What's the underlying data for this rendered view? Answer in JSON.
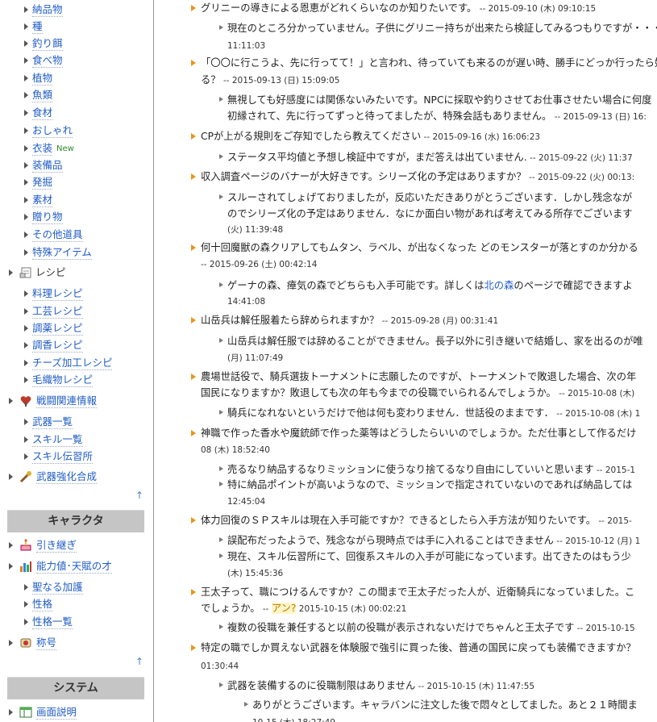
{
  "sidebar": {
    "items": [
      {
        "label": "納品物",
        "type": "link"
      },
      {
        "label": "種",
        "type": "link"
      },
      {
        "label": "釣り餌",
        "type": "link"
      },
      {
        "label": "食べ物",
        "type": "link"
      },
      {
        "label": "植物",
        "type": "link"
      },
      {
        "label": "魚類",
        "type": "link"
      },
      {
        "label": "食材",
        "type": "link"
      },
      {
        "label": "おしゃれ",
        "type": "link"
      },
      {
        "label": "衣装",
        "type": "link",
        "badge": "New"
      },
      {
        "label": "装備品",
        "type": "link"
      },
      {
        "label": "発掘",
        "type": "link"
      },
      {
        "label": "素材",
        "type": "link"
      },
      {
        "label": "贈り物",
        "type": "link"
      },
      {
        "label": "その他道具",
        "type": "link"
      },
      {
        "label": "特殊アイテム",
        "type": "link"
      },
      {
        "label": "レシピ",
        "type": "section",
        "icon": "recipe-icon"
      },
      {
        "label": "料理レシピ",
        "type": "link"
      },
      {
        "label": "工芸レシピ",
        "type": "link"
      },
      {
        "label": "調薬レシピ",
        "type": "link"
      },
      {
        "label": "調香レシピ",
        "type": "link"
      },
      {
        "label": "チーズ加工レシピ",
        "type": "link"
      },
      {
        "label": "毛織物レシピ",
        "type": "link"
      },
      {
        "label": "戦闘関連情報",
        "type": "section-link",
        "icon": "heart-shield-icon"
      },
      {
        "label": "武器一覧",
        "type": "link"
      },
      {
        "label": "スキル一覧",
        "type": "link"
      },
      {
        "label": "スキル伝習所",
        "type": "link"
      },
      {
        "label": "武器強化合成",
        "type": "section-link",
        "icon": "weapon-icon"
      }
    ],
    "chara_header": "キャラクタ",
    "chara_items": [
      {
        "label": "引き継ぎ",
        "type": "section-link",
        "icon": "cake-icon"
      },
      {
        "label": "能力値･天賦の才",
        "type": "section-link",
        "icon": "bar-chart-icon"
      },
      {
        "label": "聖なる加護",
        "type": "link"
      },
      {
        "label": "性格",
        "type": "link"
      },
      {
        "label": "性格一覧",
        "type": "link"
      },
      {
        "label": "称号",
        "type": "section-link",
        "icon": "trophy-icon"
      }
    ],
    "system_header": "システム",
    "system_items": [
      {
        "label": "画面説明",
        "type": "section-link",
        "icon": "screen-icon"
      }
    ],
    "up_arrow": "↑"
  },
  "main": {
    "lines": [
      {
        "kind": "q",
        "text": "グリニーの導きによる恩恵がどれくらいなのか知りたいです。",
        "ts": " -- 2015-09-10 (木) 09:10:15"
      },
      {
        "kind": "a",
        "text": "現在のところ分かっていません。子供にグリニー持ちが出来たら検証してみるつもりですが・・・"
      },
      {
        "kind": "c",
        "ts": "11:11:03"
      },
      {
        "kind": "q",
        "text": "「〇〇に行こうよ、先に行ってて！」と言われ、待っていても来るのが遅い時、勝手にどっか行ったら好感度は下が"
      },
      {
        "kind": "c",
        "text": "る？",
        "ts": " -- 2015-09-13 (日) 15:09:05"
      },
      {
        "kind": "a",
        "text": "無視しても好感度には関係ないみたいです。NPCに採取や釣りさせてお仕事させたい場合に何度"
      },
      {
        "kind": "c",
        "text": "初縁されて、先に行ってずっと待ってましたが、特殊会話もありません。",
        "ts": " -- 2015-09-13 (日) 16:"
      },
      {
        "kind": "q",
        "text": "CPが上がる規則をご存知でしたら教えてください",
        "ts": " -- 2015-09-16 (水) 16:06:23"
      },
      {
        "kind": "a",
        "text": "ステータス平均値と予想し検証中ですが，まだ答えは出ていません.",
        "ts": "  -- 2015-09-22 (火) 11:37"
      },
      {
        "kind": "q",
        "text": "収入調査ページのバナーが大好きです。シリーズ化の予定はありますか？",
        "ts": " -- 2015-09-22 (火) 00:13:"
      },
      {
        "kind": "a",
        "text": "スルーされてしょげておりましたが，反応いただきありがとうございます．しかし残念なが"
      },
      {
        "kind": "c",
        "text": "のでシリーズ化の予定はありません．なにか面白い物があれば考えてみる所存でございます"
      },
      {
        "kind": "c",
        "ts": "(火) 11:39:48"
      },
      {
        "kind": "q",
        "text": "何十回魔獣の森クリアしてもムタン、ラベル、が出なくなった どのモンスターが落とすのか分かる"
      },
      {
        "kind": "c",
        "ts": "-- 2015-09-26 (土) 00:42:14"
      },
      {
        "kind": "a",
        "text": "ゲーナの森、瘴気の森でどちらも入手可能です。詳しくは",
        "link": "北の森",
        "after": "のページで確認できますよ"
      },
      {
        "kind": "c",
        "ts": "14:41:08"
      },
      {
        "kind": "q",
        "text": "山岳兵は解任服着たら辞められますか？",
        "ts": " -- 2015-09-28 (月) 00:31:41"
      },
      {
        "kind": "a",
        "text": "山岳兵は解任服では辞めることができません。長子以外に引き継いで結婚し、家を出るのが唯"
      },
      {
        "kind": "c",
        "ts": "(月) 11:07:49"
      },
      {
        "kind": "q",
        "text": "農場世話役で、騎兵選抜トーナメントに志願したのですが、トーナメントで敗退した場合、次の年"
      },
      {
        "kind": "c",
        "text": "国民になりますか？敗退しても次の年も今までの役職でいられるんでしょうか。",
        "ts": " -- 2015-10-08 (木)"
      },
      {
        "kind": "a",
        "text": "騎兵になれないというだけで他は何も変わりません．世話役のままです．",
        "ts": "  -- 2015-10-08 (木) 1"
      },
      {
        "kind": "q",
        "text": "神職で作った香水や魔銃師で作った薬等はどうしたらいいのでしょうか。ただ仕事として作るだけ"
      },
      {
        "kind": "c",
        "ts": "08 (木) 18:52:40"
      },
      {
        "kind": "a",
        "text": "売るなり納品するなりミッションに使うなり捨てるなり自由にしていいと思います",
        "ts": " -- 2015-1"
      },
      {
        "kind": "a",
        "text": "特に納品ポイントが高いようなので、ミッションで指定されていないのであれば納品しては"
      },
      {
        "kind": "c",
        "ts": "12:45:04"
      },
      {
        "kind": "q",
        "text": "体力回復のＳＰスキルは現在入手可能ですか？できるとしたら入手方法が知りたいです。",
        "ts": "  -- 2015-"
      },
      {
        "kind": "a",
        "text": "誤配布だったようで、残念ながら現時点では手に入れることはできません",
        "ts": " -- 2015-10-12 (月) 1"
      },
      {
        "kind": "a",
        "text": "現在、スキル伝習所にて、回復系スキルの入手が可能になっています。出てきたのはもう少"
      },
      {
        "kind": "c",
        "ts": "(木) 15:45:36"
      },
      {
        "kind": "q",
        "text": "王太子って、職につけるんですか？この間まで王太子だった人が、近衛騎兵になっていました。こ"
      },
      {
        "kind": "c",
        "text": "でしょうか。",
        "ts_prefix": " -- ",
        "hl": "アン",
        "hl_q": "?",
        "ts": " 2015-10-15 (木) 00:02:21"
      },
      {
        "kind": "a",
        "text": "複数の役職を兼任すると以前の役職が表示されないだけでちゃんと王太子です",
        "ts": " -- 2015-10-15"
      },
      {
        "kind": "q",
        "text": "特定の職でしか買えない武器を体験服で強引に買った後、普通の国民に戻っても装備できますか？"
      },
      {
        "kind": "c",
        "ts": "01:30:44"
      },
      {
        "kind": "a",
        "text": "武器を装備するのに役職制限はありません",
        "ts": " -- 2015-10-15 (木) 11:47:55"
      },
      {
        "kind": "a2",
        "text": "ありがとうございます。キャラバンに注文した後で悶々としてました。あと２１時間ま"
      },
      {
        "kind": "c2",
        "ts": "10-15 (木) 18:27:49"
      }
    ]
  }
}
